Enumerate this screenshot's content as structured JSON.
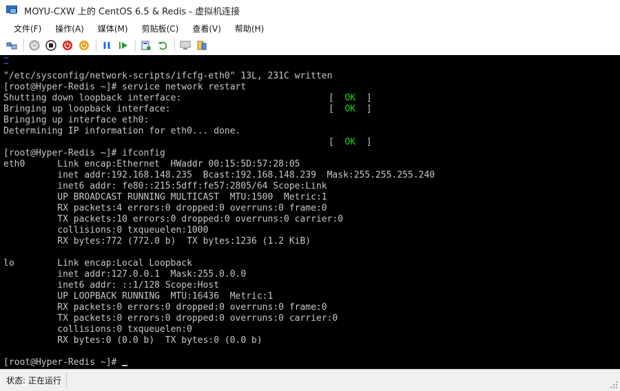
{
  "window": {
    "title": "MOYU-CXW 上的 CentOS 6.5 & Redis - 虚拟机连接"
  },
  "menu": {
    "items": [
      "文件(F)",
      "操作(A)",
      "媒体(M)",
      "剪贴板(C)",
      "查看(V)",
      "帮助(H)"
    ]
  },
  "toolbar": {
    "icons": [
      "ctrl-alt-del-icon",
      "start-icon",
      "turn-off-icon",
      "shutdown-icon",
      "save-icon",
      "pause-icon",
      "resume-icon",
      "checkpoint-icon",
      "revert-icon",
      "enhanced-session-icon",
      "share-icon"
    ]
  },
  "terminal": {
    "lines": [
      "~",
      "~",
      "\"/etc/sysconfig/network-scripts/ifcfg-eth0\" 13L, 231C written",
      "[root@Hyper-Redis ~]# service network restart",
      "Shutting down loopback interface:",
      "Bringing up loopback interface:",
      "Bringing up interface eth0:",
      "Determining IP information for eth0... done.",
      "",
      "[root@Hyper-Redis ~]# ifconfig",
      "eth0      Link encap:Ethernet  HWaddr 00:15:5D:57:28:05",
      "          inet addr:192.168.148.235  Bcast:192.168.148.239  Mask:255.255.255.240",
      "          inet6 addr: fe80::215:5dff:fe57:2805/64 Scope:Link",
      "          UP BROADCAST RUNNING MULTICAST  MTU:1500  Metric:1",
      "          RX packets:4 errors:0 dropped:0 overruns:0 frame:0",
      "          TX packets:10 errors:0 dropped:0 overruns:0 carrier:0",
      "          collisions:0 txqueuelen:1000",
      "          RX bytes:772 (772.0 b)  TX bytes:1236 (1.2 KiB)",
      "",
      "lo        Link encap:Local Loopback",
      "          inet addr:127.0.0.1  Mask:255.0.0.0",
      "          inet6 addr: ::1/128 Scope:Host",
      "          UP LOOPBACK RUNNING  MTU:16436  Metric:1",
      "          RX packets:0 errors:0 dropped:0 overruns:0 frame:0",
      "          TX packets:0 errors:0 dropped:0 overruns:0 carrier:0",
      "          collisions:0 txqueuelen:0",
      "          RX bytes:0 (0.0 b)  TX bytes:0 (0.0 b)",
      "",
      "[root@Hyper-Redis ~]# "
    ],
    "ok_marks": [
      "[  OK  ]",
      "[  OK  ]",
      "[  OK  ]"
    ]
  },
  "status": {
    "text": "状态: 正在运行"
  },
  "colors": {
    "terminal_bg": "#000000",
    "terminal_fg": "#c8c8c8",
    "ok_green": "#1fd21f",
    "tilde_blue": "#4d6cf0"
  }
}
